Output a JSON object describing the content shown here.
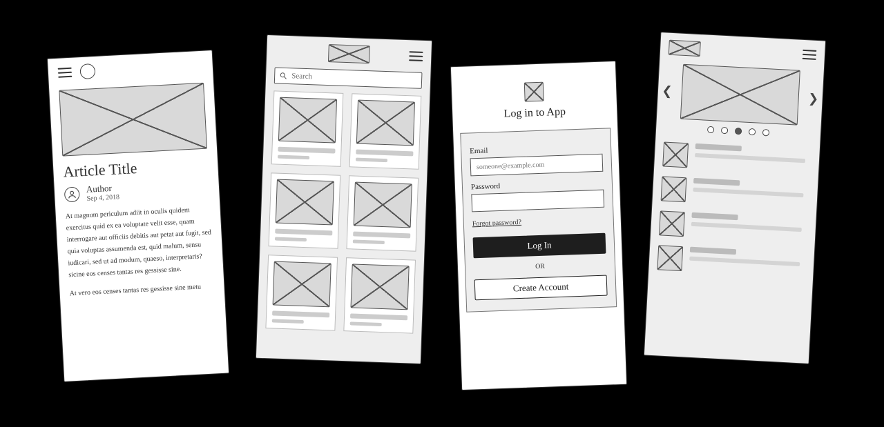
{
  "article": {
    "title": "Article Title",
    "author": "Author",
    "date": "Sep 4, 2018",
    "para1": "At magnum periculum adiit in oculis quidem exercitus quid ex ea voluptate velit esse, quam interrogare aut officiis debitis aut petat aut fugit, sed quia voluptas assumenda est, quid malum, sensu iudicari, sed ut ad modum, quaeso, interpretaris? sicine eos censes tantas res gessisse sine.",
    "para2": "At vero eos censes tantas res gessisse sine metu"
  },
  "gallery": {
    "search_placeholder": "Search"
  },
  "login": {
    "title": "Log in to App",
    "email_label": "Email",
    "email_placeholder": "someone@example.com",
    "password_label": "Password",
    "forgot": "Forgot password?",
    "login_btn": "Log In",
    "or": "OR",
    "create_btn": "Create Account"
  },
  "feed": {
    "active_dot_index": 2,
    "dot_count": 5,
    "list_count": 4
  }
}
